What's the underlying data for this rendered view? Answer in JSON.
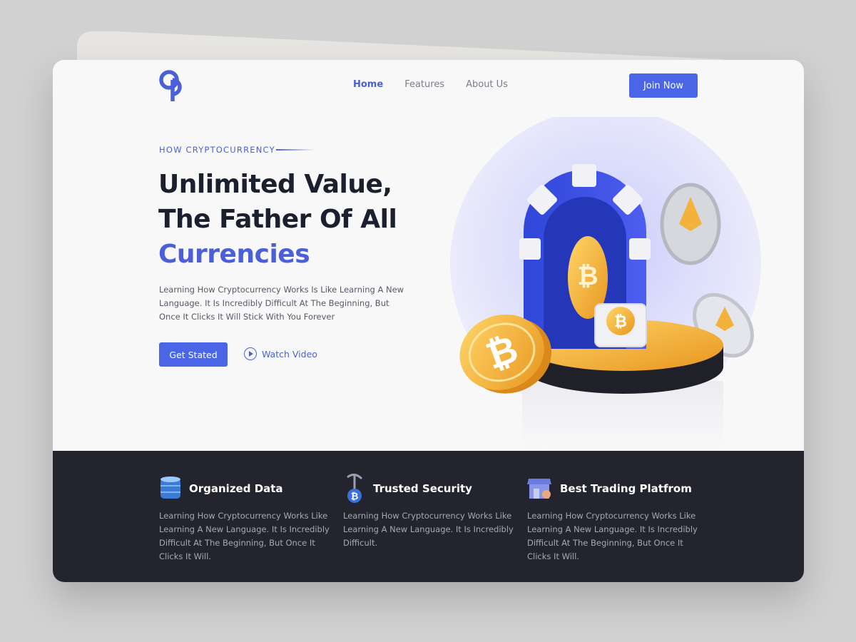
{
  "brand": {
    "logo_text": "CP"
  },
  "nav": {
    "items": [
      {
        "label": "Home",
        "active": true
      },
      {
        "label": "Features",
        "active": false
      },
      {
        "label": "About Us",
        "active": false
      }
    ],
    "join_label": "Join Now"
  },
  "hero": {
    "eyebrow": "HOW CRYPTOCURRENCY",
    "headline_line1": "Unlimited Value,",
    "headline_line2": "The Father Of All",
    "headline_accent": "Currencies",
    "description": "Learning How Cryptocurrency Works Is Like Learning A New Language. It Is Incredibly Difficult At The Beginning, But Once It Clicks It Will Stick With You Forever",
    "cta_label": "Get Stated",
    "watch_label": "Watch Video",
    "coin_symbol": "₿"
  },
  "features": [
    {
      "icon": "database-icon",
      "title": "Organized Data",
      "description": "Learning How Cryptocurrency Works Like Learning A New Language. It Is Incredibly Difficult At The Beginning, But Once It Clicks It Will."
    },
    {
      "icon": "pickaxe-bitcoin-icon",
      "title": "Trusted Security",
      "description": "Learning How Cryptocurrency Works Like Learning A New Language. It Is Incredibly Difficult."
    },
    {
      "icon": "storefront-icon",
      "title": "Best Trading Platfrom",
      "description": "Learning How Cryptocurrency Works Like Learning A New Language. It Is Incredibly Difficult At The Beginning, But Once It Clicks It Will."
    }
  ],
  "colors": {
    "accent": "#4a66e6",
    "dark": "#24242f",
    "headline": "#1c1f2e",
    "coin": "#f4b73a"
  }
}
